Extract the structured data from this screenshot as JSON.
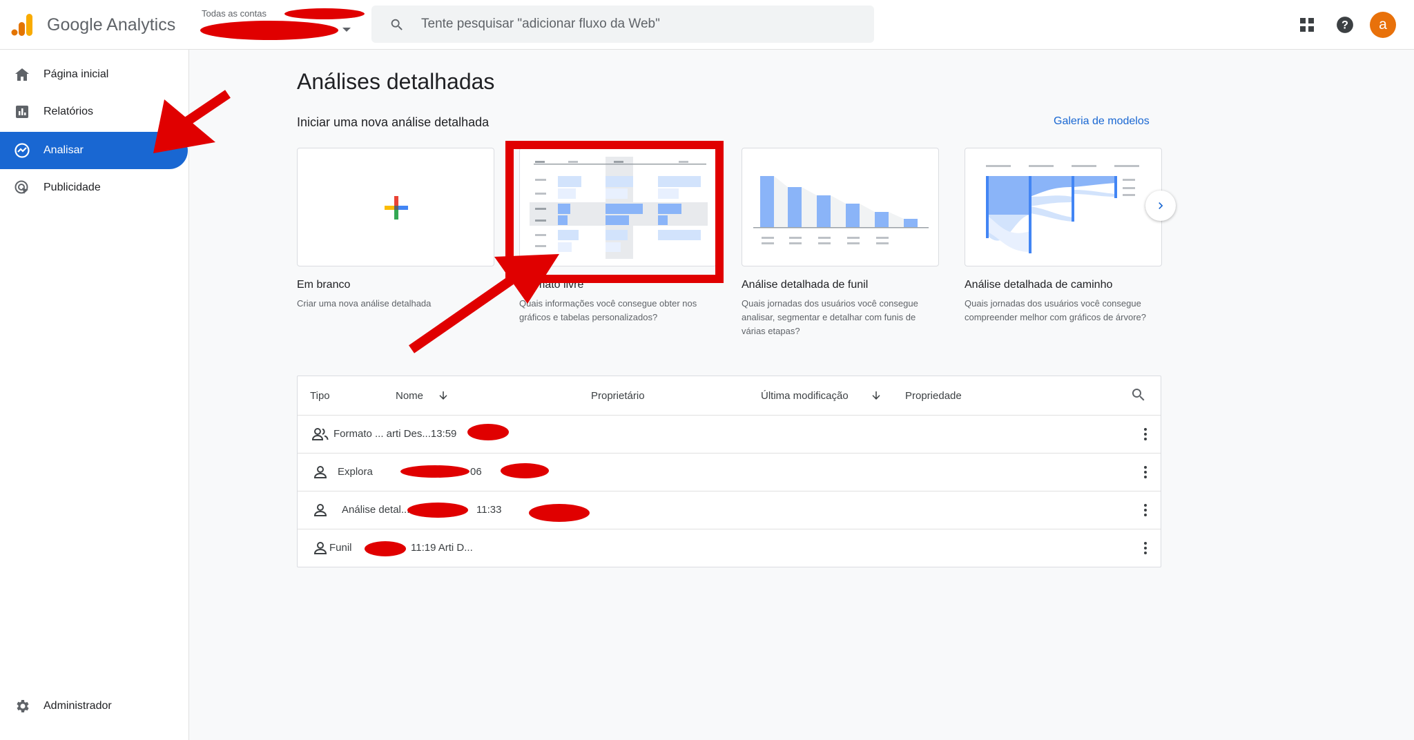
{
  "app": {
    "title": "Google Analytics",
    "account_crumb": "Todas as contas"
  },
  "search": {
    "placeholder": "Tente pesquisar \"adicionar fluxo da Web\""
  },
  "header": {
    "apps_icon": "grid-icon",
    "help_icon": "help-icon",
    "avatar_letter": "a",
    "avatar_color": "#e8710a"
  },
  "sidebar": {
    "items": [
      {
        "label": "Página inicial",
        "icon": "home-icon"
      },
      {
        "label": "Relatórios",
        "icon": "bar-chart-icon"
      },
      {
        "label": "Analisar",
        "icon": "explore-icon",
        "active": true
      },
      {
        "label": "Publicidade",
        "icon": "ads-icon"
      }
    ],
    "admin_label": "Administrador",
    "accent": "#1967d2"
  },
  "main": {
    "title": "Análises detalhadas",
    "section_title": "Iniciar uma nova análise detalhada",
    "gallery_link": "Galeria de modelos",
    "templates": [
      {
        "title": "Em branco",
        "description": "Criar uma nova análise detalhada"
      },
      {
        "title": "Formato livre",
        "description": "Quais informações você consegue obter nos gráficos e tabelas personalizados?"
      },
      {
        "title": "Análise detalhada de funil",
        "description": "Quais jornadas dos usuários você consegue analisar, segmentar e detalhar com funis de várias etapas?"
      },
      {
        "title": "Análise detalhada de caminho",
        "description": "Quais jornadas dos usuários você consegue compreender melhor com gráficos de árvore?"
      }
    ]
  },
  "table": {
    "headers": {
      "type": "Tipo",
      "name": "Nome",
      "owner": "Proprietário",
      "modified": "Última modificação",
      "property": "Propriedade"
    },
    "rows": [
      {
        "text": "Formato ... arti Des...13:59",
        "icon": "people-icon"
      },
      {
        "text": "Explora",
        "time": "06",
        "icon": "person-icon"
      },
      {
        "text": "Análise detal...",
        "time": "11:33",
        "icon": "person-icon"
      },
      {
        "text": "Funil",
        "time": "11:19  Arti D...",
        "icon": "person-icon"
      }
    ]
  }
}
